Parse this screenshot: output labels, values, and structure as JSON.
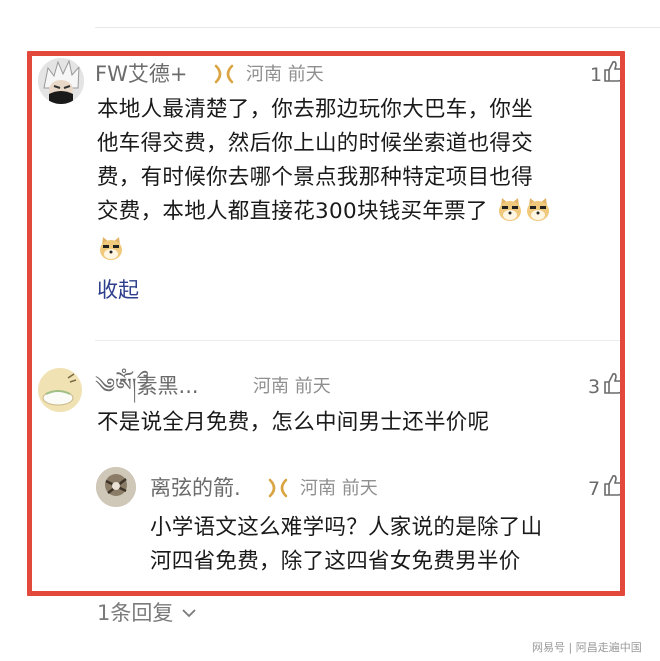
{
  "comments": [
    {
      "username": "FW艾德+",
      "location": "河南",
      "time": "前天",
      "likes": "1",
      "text_lines": [
        "本地人最清楚了，你去那边玩你大巴车，你坐",
        "他车得交费，然后你上山的时候坐索道也得交",
        "费，有时候你去哪个景点我那种特定项目也得",
        "交费，本地人都直接花300块钱买年票了"
      ],
      "collapse_label": "收起"
    },
    {
      "username": "༄ༀ།ྀ素黑...",
      "location": "河南",
      "time": "前天",
      "likes": "3",
      "text_lines": [
        "不是说全月免费，怎么中间男士还半价呢"
      ]
    }
  ],
  "reply": {
    "username": "离弦的箭.",
    "location": "河南",
    "time": "前天",
    "likes": "7",
    "text_lines": [
      "小学语文这么难学吗？人家说的是除了山",
      "河四省免费，除了这四省女免费男半价"
    ]
  },
  "reply_count_label": "1条回复",
  "watermark": "网易号 | 阿昌走遍中国",
  "colors": {
    "frame": "#e2493b",
    "link": "#2d3f8c",
    "meta": "#8f8f8f"
  },
  "icons": [
    "like-thumb-icon",
    "vip-badge-icon",
    "doge-emoji-icon",
    "chevron-down-icon"
  ]
}
